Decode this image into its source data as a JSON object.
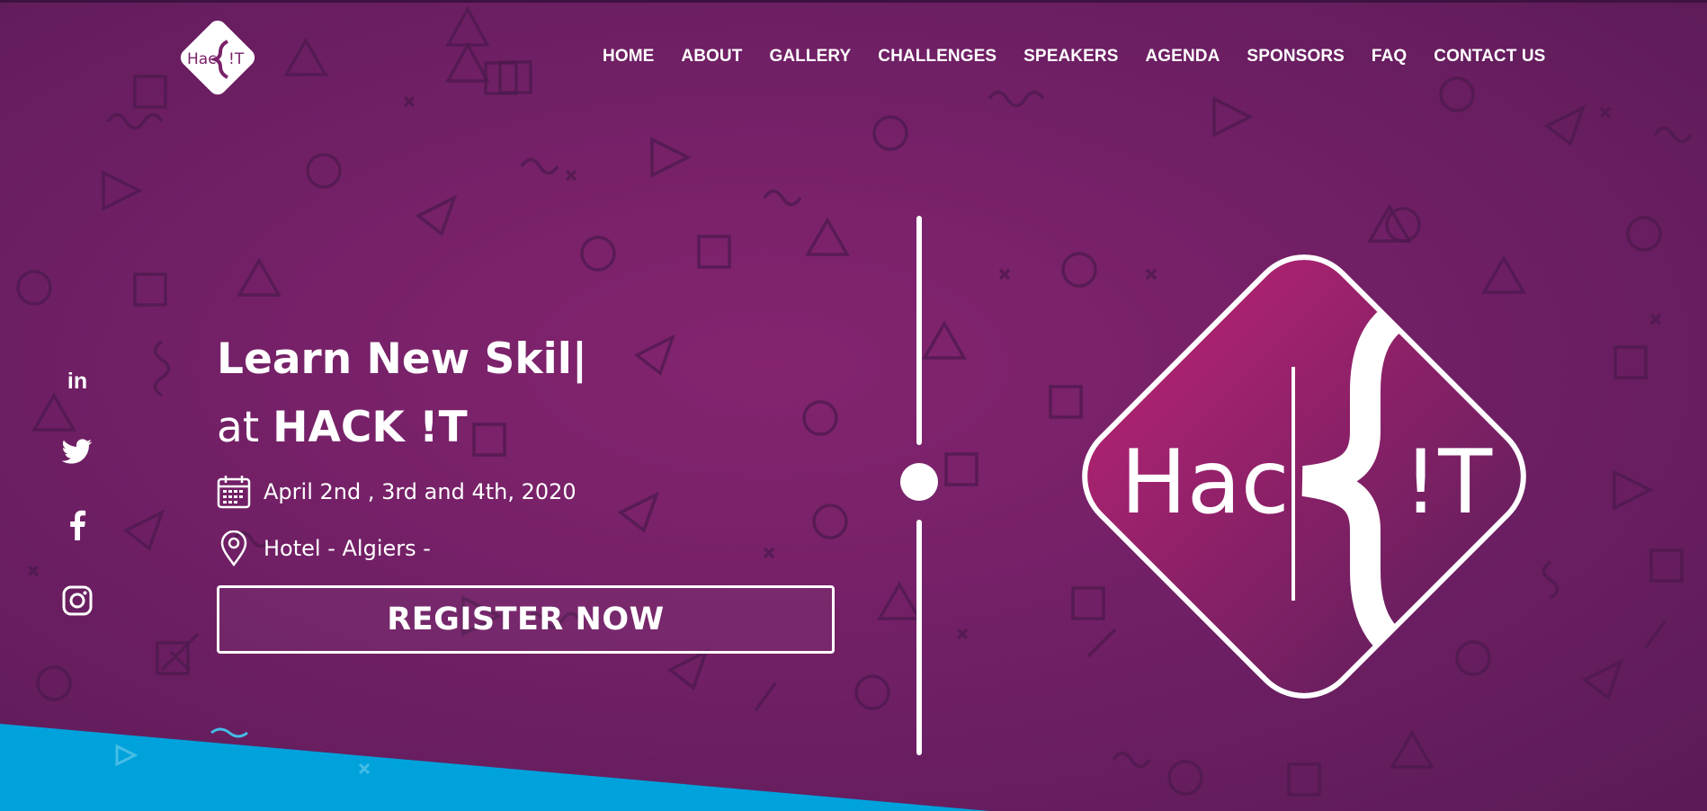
{
  "brand": {
    "logo_text_left": "Hac",
    "logo_text_right": "!T"
  },
  "nav": {
    "items": [
      {
        "label": "HOME"
      },
      {
        "label": "ABOUT"
      },
      {
        "label": "GALLERY"
      },
      {
        "label": "CHALLENGES"
      },
      {
        "label": "SPEAKERS"
      },
      {
        "label": "AGENDA"
      },
      {
        "label": "SPONSORS"
      },
      {
        "label": "FAQ"
      },
      {
        "label": "CONTACT US"
      }
    ]
  },
  "social": {
    "icons": [
      "linkedin-icon",
      "twitter-icon",
      "facebook-icon",
      "instagram-icon"
    ],
    "linkedin_label": "in"
  },
  "hero": {
    "line1": "Learn New Skil|",
    "line2_prefix": "at ",
    "line2_strong": "HACK !T",
    "date": "April 2nd , 3rd and 4th, 2020",
    "location": "Hotel - Algiers -",
    "register_label": "REGISTER NOW"
  },
  "colors": {
    "background": "#74215f",
    "accent_blue": "#009fd8",
    "text": "#ffffff"
  }
}
